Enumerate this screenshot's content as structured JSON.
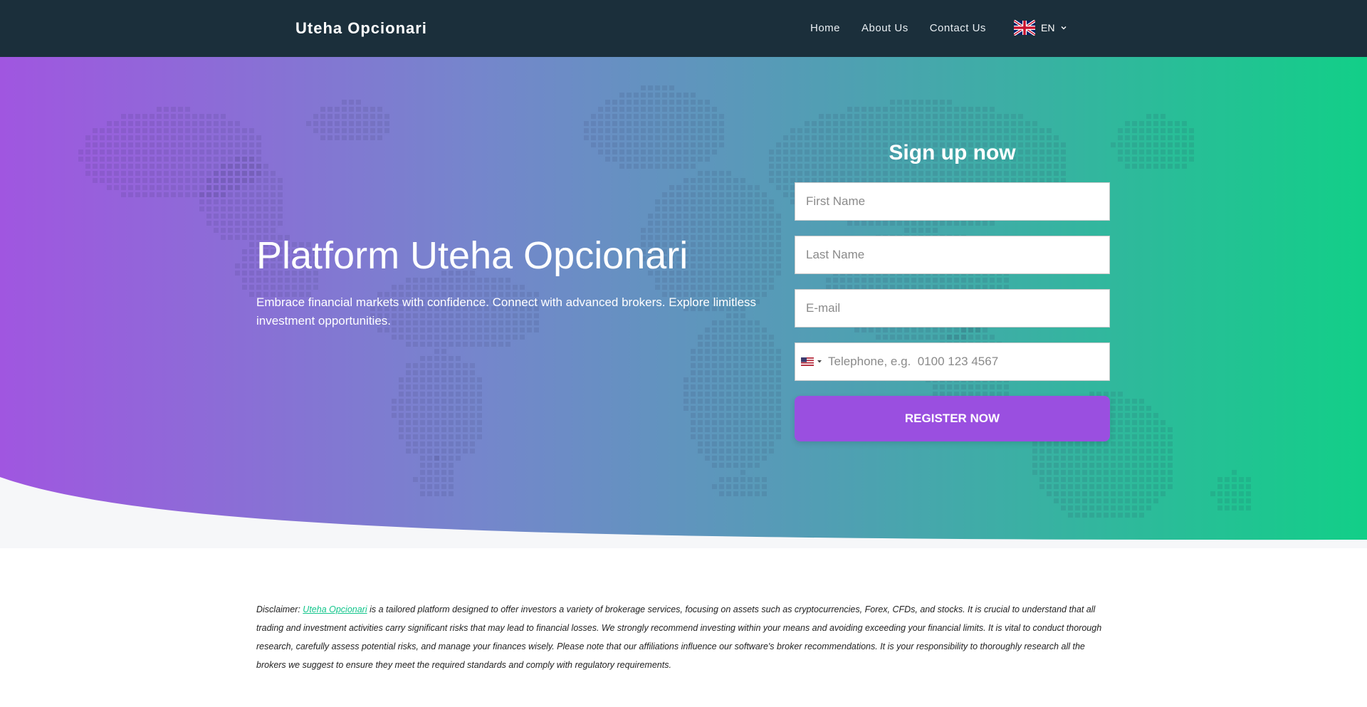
{
  "header": {
    "brand": "Uteha Opcionari",
    "nav": [
      "Home",
      "About Us",
      "Contact Us"
    ],
    "language": "EN"
  },
  "hero": {
    "title": "Platform Uteha Opcionari",
    "subtitle": "Embrace financial markets with confidence. Connect with advanced brokers. Explore limitless investment opportunities."
  },
  "form": {
    "title": "Sign up now",
    "first_name_placeholder": "First Name",
    "last_name_placeholder": "Last Name",
    "email_placeholder": "E-mail",
    "phone_placeholder": "Telephone, e.g.  0100 123 4567",
    "register_label": "REGISTER NOW"
  },
  "disclaimer": {
    "prefix": "Disclaimer: ",
    "link_text": "Uteha Opcionari",
    "body": " is a tailored platform designed to offer investors a variety of brokerage services, focusing on assets such as cryptocurrencies, Forex, CFDs, and stocks. It is crucial to understand that all trading and investment activities carry significant risks that may lead to financial losses. We strongly recommend investing within your means and avoiding exceeding your financial limits. It is vital to conduct thorough research, carefully assess potential risks, and manage your finances wisely. Please note that our affiliations influence our software's broker recommendations. It is your responsibility to thoroughly research all the brokers we suggest to ensure they meet the required standards and comply with regulatory requirements."
  },
  "colors": {
    "header_bg": "#1b2f3b",
    "gradient_start": "#a056e0",
    "gradient_end": "#12cf88",
    "button": "#9a4fe0",
    "link": "#12c58b"
  }
}
